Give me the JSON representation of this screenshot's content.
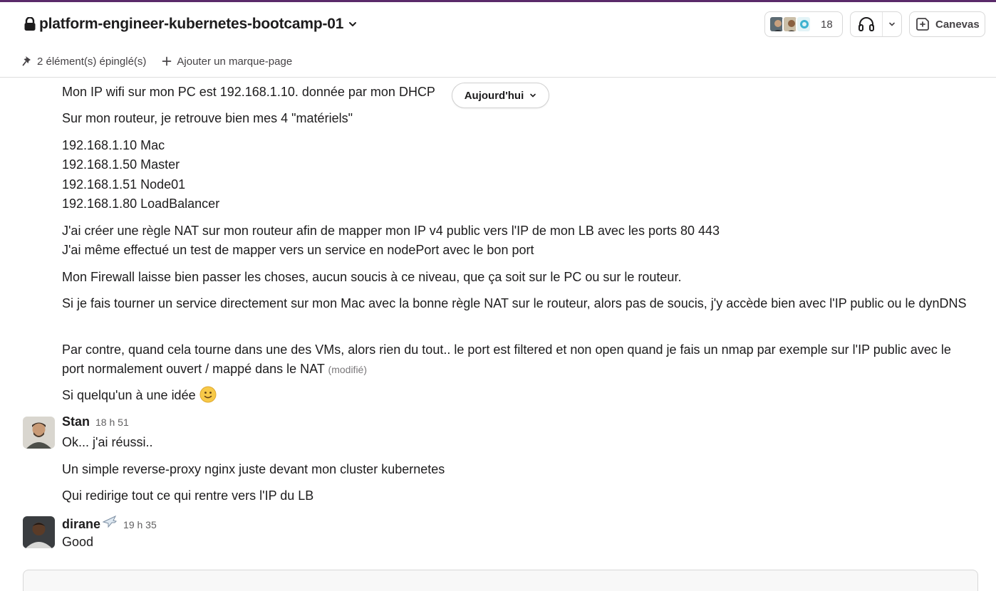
{
  "header": {
    "channel_name": "platform-engineer-kubernetes-bootcamp-01",
    "pinned_label": "2 élément(s) épinglé(s)",
    "add_bookmark_label": "Ajouter un marque-page",
    "members_count": "18",
    "canvas_label": "Canevas"
  },
  "date_divider": {
    "label": "Aujourd'hui"
  },
  "messages": {
    "first_block": {
      "lines": [
        "Mon IP wifi sur mon PC est 192.168.1.10. donnée par mon DHCP",
        "Sur mon routeur, je retrouve bien mes 4 \"matériels\"",
        "192.168.1.10 Mac",
        "192.168.1.50 Master",
        "192.168.1.51 Node01",
        "192.168.1.80 LoadBalancer",
        "J'ai créer une règle NAT sur mon routeur afin de mapper mon IP v4 public vers l'IP de mon LB avec les ports 80 443",
        "J'ai même effectué un test de mapper vers un service en nodePort avec le bon port",
        "Mon Firewall laisse bien passer les choses, aucun soucis à ce niveau, que ça soit sur le PC ou sur le routeur.",
        "Si je fais tourner un service directement sur mon Mac avec la bonne règle NAT sur le routeur, alors pas de soucis, j'y accède bien avec l'IP public ou le dynDNS",
        "Par contre, quand cela tourne dans une des VMs, alors rien du tout.. le port est filtered et non open quand je fais un nmap par exemple sur l'IP public avec le port normalement ouvert / mappé dans le NAT",
        "Si quelqu'un à une idée"
      ],
      "edited_label": "(modifié)",
      "emoji": "slightly-smiling-face"
    },
    "stan": {
      "author": "Stan",
      "time": "18 h 51",
      "lines": [
        "Ok... j'ai réussi..",
        "Un simple reverse-proxy nginx juste devant mon cluster kubernetes",
        "Qui redirige tout ce qui rentre vers l'IP du LB"
      ]
    },
    "dirane": {
      "author": "dirane",
      "status_emoji": "airplane",
      "time": "19 h 35",
      "lines": [
        "Good"
      ]
    }
  },
  "colors": {
    "accent": "#5a2a6a",
    "text": "#1d1c1d",
    "muted": "#616061",
    "border": "#dddddd"
  }
}
